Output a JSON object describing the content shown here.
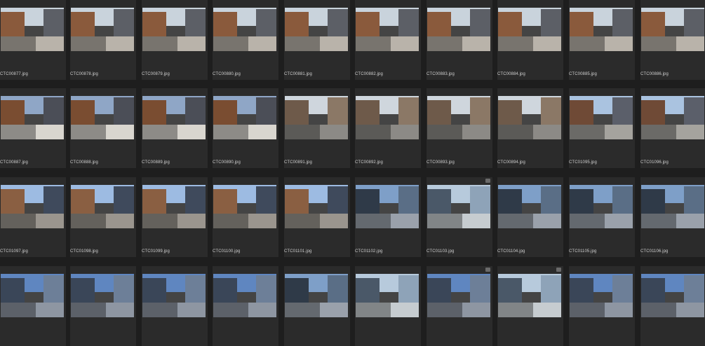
{
  "thumbnails": [
    {
      "label": "CTC00877.jpg",
      "tone": "brick",
      "badge": false
    },
    {
      "label": "CTC00878.jpg",
      "tone": "brick",
      "badge": false
    },
    {
      "label": "CTC00879.jpg",
      "tone": "brick",
      "badge": false
    },
    {
      "label": "CTC00880.jpg",
      "tone": "brick",
      "badge": false
    },
    {
      "label": "CTC00881.jpg",
      "tone": "brick",
      "badge": false
    },
    {
      "label": "CTC00882.jpg",
      "tone": "brick",
      "badge": false
    },
    {
      "label": "CTC00883.jpg",
      "tone": "brick",
      "badge": false
    },
    {
      "label": "CTC00884.jpg",
      "tone": "brick",
      "badge": false
    },
    {
      "label": "CTC00885.jpg",
      "tone": "brick",
      "badge": false
    },
    {
      "label": "CTC00886.jpg",
      "tone": "brick",
      "badge": false
    },
    {
      "label": "CTC00887.jpg",
      "tone": "brick-shadow",
      "badge": false
    },
    {
      "label": "CTC00888.jpg",
      "tone": "brick-shadow",
      "badge": false
    },
    {
      "label": "CTC00889.jpg",
      "tone": "brick-shadow",
      "badge": false
    },
    {
      "label": "CTC00890.jpg",
      "tone": "brick-shadow",
      "badge": false
    },
    {
      "label": "CTC00891.jpg",
      "tone": "plaza",
      "badge": false
    },
    {
      "label": "CTC00892.jpg",
      "tone": "plaza",
      "badge": false
    },
    {
      "label": "CTC00893.jpg",
      "tone": "plaza",
      "badge": false
    },
    {
      "label": "CTC00894.jpg",
      "tone": "plaza",
      "badge": false
    },
    {
      "label": "CTC01095.jpg",
      "tone": "street",
      "badge": false
    },
    {
      "label": "CTC01096.jpg",
      "tone": "street",
      "badge": false
    },
    {
      "label": "CTC01097.jpg",
      "tone": "garden",
      "badge": false
    },
    {
      "label": "CTC01098.jpg",
      "tone": "garden",
      "badge": false
    },
    {
      "label": "CTC01099.jpg",
      "tone": "garden",
      "badge": false
    },
    {
      "label": "CTC01100.jpg",
      "tone": "garden",
      "badge": false
    },
    {
      "label": "CTC01101.jpg",
      "tone": "garden",
      "badge": false
    },
    {
      "label": "CTC01102.jpg",
      "tone": "glass",
      "badge": false
    },
    {
      "label": "CTC01103.jpg",
      "tone": "glass-bright",
      "badge": true
    },
    {
      "label": "CTC01104.jpg",
      "tone": "glass",
      "badge": false
    },
    {
      "label": "CTC01105.jpg",
      "tone": "glass",
      "badge": false
    },
    {
      "label": "CTC01106.jpg",
      "tone": "glass",
      "badge": false
    },
    {
      "label": "",
      "tone": "blue-street",
      "badge": false
    },
    {
      "label": "",
      "tone": "blue-street",
      "badge": false
    },
    {
      "label": "",
      "tone": "blue-street",
      "badge": false
    },
    {
      "label": "",
      "tone": "blue-street",
      "badge": false
    },
    {
      "label": "",
      "tone": "glass",
      "badge": false
    },
    {
      "label": "",
      "tone": "glass-bright",
      "badge": false
    },
    {
      "label": "",
      "tone": "blue-street",
      "badge": true
    },
    {
      "label": "",
      "tone": "glass-bright",
      "badge": true
    },
    {
      "label": "",
      "tone": "blue-street",
      "badge": false
    },
    {
      "label": "",
      "tone": "blue-street",
      "badge": false
    }
  ],
  "tones": {
    "brick": {
      "sky": "#c9d3dc",
      "left": "#8a5a3c",
      "right": "#5c5f66",
      "ground": "#b9b3aa"
    },
    "brick-shadow": {
      "sky": "#8fa6c6",
      "left": "#7a4d31",
      "right": "#4b4e57",
      "ground": "#d9d6cf"
    },
    "plaza": {
      "sky": "#cfd6dd",
      "left": "#6e5a4a",
      "right": "#8b7866",
      "ground": "#8c8a86"
    },
    "street": {
      "sky": "#aac3e0",
      "left": "#6f4a36",
      "right": "#5b5f6a",
      "ground": "#a5a39e"
    },
    "garden": {
      "sky": "#9dbbe2",
      "left": "#8a5f42",
      "right": "#3f4a5c",
      "ground": "#9a958e"
    },
    "glass": {
      "sky": "#7e9fc8",
      "left": "#2f3a48",
      "right": "#5a6e86",
      "ground": "#9aa1ab"
    },
    "glass-bright": {
      "sky": "#b7cadc",
      "left": "#4a5868",
      "right": "#8ea3b8",
      "ground": "#c6ccd0"
    },
    "blue-street": {
      "sky": "#5f86c0",
      "left": "#3a4658",
      "right": "#6d7f98",
      "ground": "#8e96a2"
    }
  }
}
